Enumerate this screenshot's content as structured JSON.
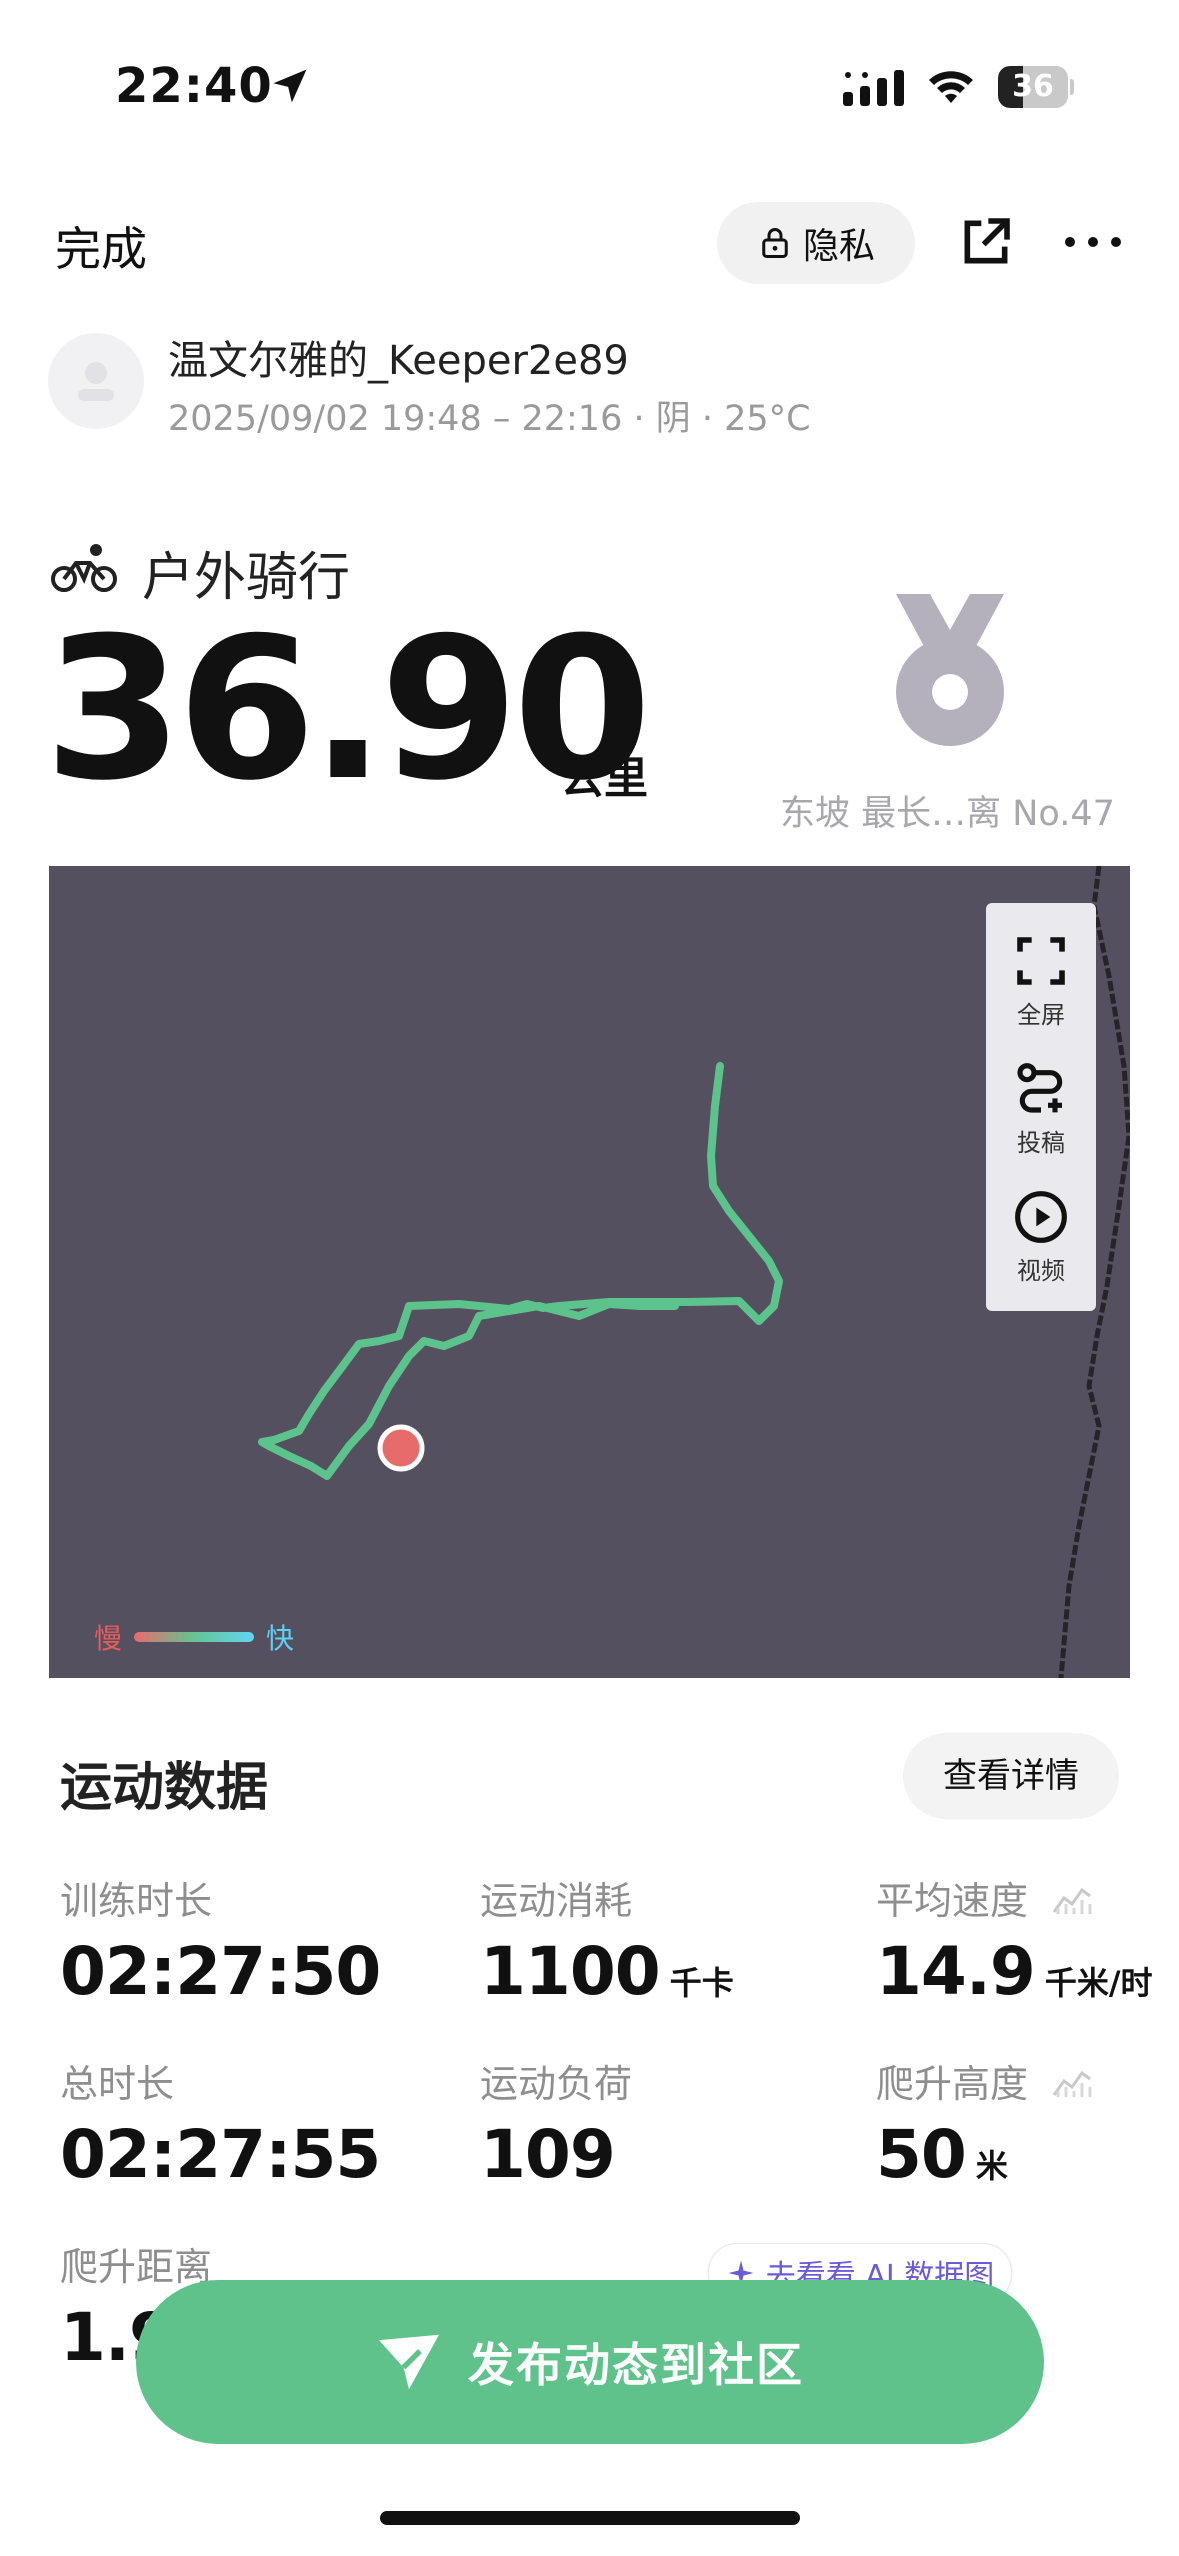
{
  "status_bar": {
    "time": "22:40",
    "battery": "36",
    "battery_fraction": 0.36
  },
  "header": {
    "done_label": "完成",
    "privacy_label": "隐私"
  },
  "user": {
    "name": "温文尔雅的_Keeper2e89",
    "meta": "2025/09/02 19:48 – 22:16 · 阴 · 25°C"
  },
  "activity": {
    "type": "户外骑行",
    "distance": "36.90",
    "distance_unit": "公里",
    "medal_caption": "东坡 最长…离 No.47"
  },
  "map": {
    "tools": [
      {
        "label": "全屏",
        "icon": "fullscreen-icon"
      },
      {
        "label": "投稿",
        "icon": "route-submit-icon"
      },
      {
        "label": "视频",
        "icon": "play-video-icon"
      }
    ],
    "legend": {
      "slow": "慢",
      "fast": "快"
    },
    "colors": {
      "background": "#555060",
      "route": "#5dc38c",
      "start_marker": "#e86b6b"
    }
  },
  "stats": {
    "title": "运动数据",
    "details_label": "查看详情",
    "items": [
      {
        "label": "训练时长",
        "value": "02:27:50",
        "unit": ""
      },
      {
        "label": "运动消耗",
        "value": "1100",
        "unit": "千卡"
      },
      {
        "label": "平均速度",
        "value": "14.9",
        "unit": "千米/时"
      },
      {
        "label": "总时长",
        "value": "02:27:55",
        "unit": ""
      },
      {
        "label": "运动负荷",
        "value": "109",
        "unit": ""
      },
      {
        "label": "爬升高度",
        "value": "50",
        "unit": "米"
      },
      {
        "label": "爬升距离",
        "value": "1.9",
        "unit": ""
      }
    ]
  },
  "ai_link": {
    "label": "去看看 AI 数据图"
  },
  "publish": {
    "label": "发布动态到社区"
  }
}
